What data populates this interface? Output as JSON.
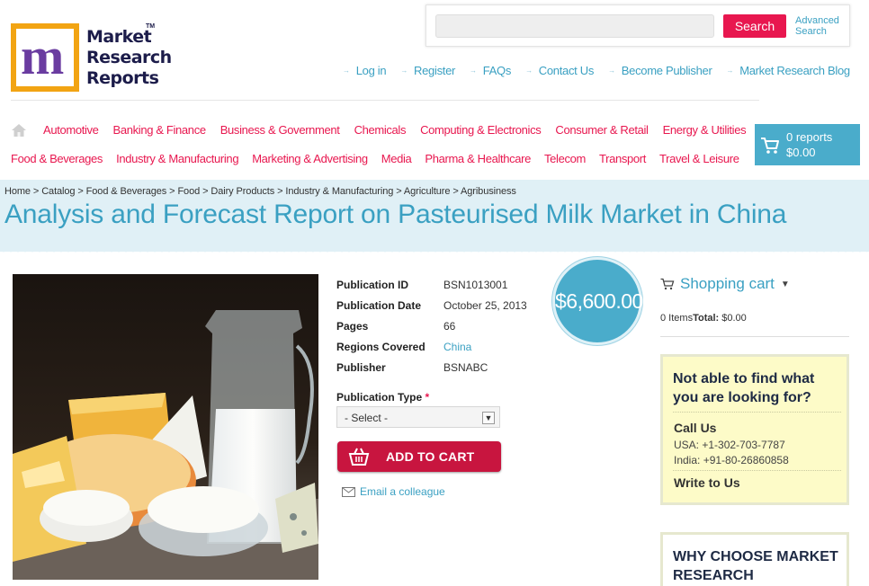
{
  "brand": {
    "logo_letter": "m",
    "name_line1": "Market",
    "name_line2": "Research",
    "name_line3": "Reports",
    "trademark": "TM"
  },
  "search": {
    "placeholder": "",
    "button_label": "Search",
    "advanced_line1": "Advanced",
    "advanced_line2": "Search"
  },
  "top_links": [
    "Log in",
    "Register",
    "FAQs",
    "Contact Us",
    "Become Publisher",
    "Market Research Blog"
  ],
  "categories_row1": [
    "Automotive",
    "Banking & Finance",
    "Business & Government",
    "Chemicals",
    "Computing & Electronics",
    "Consumer & Retail",
    "Energy & Utilities"
  ],
  "categories_row2": [
    "Food & Beverages",
    "Industry & Manufacturing",
    "Marketing & Advertising",
    "Media",
    "Pharma & Healthcare",
    "Telecom",
    "Transport",
    "Travel & Leisure"
  ],
  "cart": {
    "count_label": "0 reports",
    "total": "$0.00"
  },
  "breadcrumb": [
    "Home",
    "Catalog",
    "Food & Beverages",
    "Food",
    "Dairy Products",
    "Industry & Manufacturing",
    "Agriculture",
    "Agribusiness"
  ],
  "breadcrumb_sep": " > ",
  "page_title": "Analysis and Forecast Report on Pasteurised Milk Market in China",
  "product": {
    "price": "$6,600.00",
    "specs": [
      {
        "label": "Publication ID",
        "value": "BSN1013001"
      },
      {
        "label": "Publication Date",
        "value": "October 25, 2013"
      },
      {
        "label": "Pages",
        "value": "66"
      },
      {
        "label": "Regions Covered",
        "value": "China"
      },
      {
        "label": "Publisher",
        "value": "BSNABC"
      }
    ],
    "pubtype_label": "Publication Type",
    "required_mark": "*",
    "pubtype_selected": "- Select -",
    "add_to_cart": "ADD TO CART",
    "email_colleague": "Email a colleague"
  },
  "sidebar": {
    "shopping_cart_title": "Shopping cart",
    "items_text": "0 Items",
    "total_label": "Total:",
    "total_value": "$0.00",
    "help_question": "Not able to find what you are looking for?",
    "call_us": "Call Us",
    "usa_phone": "USA: +1-302-703-7787",
    "india_phone": "India: +91-80-26860858",
    "write_to_us": "Write to Us",
    "why_choose": "WHY CHOOSE MARKET RESEARCH"
  },
  "colors": {
    "accent_blue": "#3aa0c2",
    "accent_pink": "#e8174f",
    "cart_blue": "#4aaccb",
    "band_bg": "#e0f0f6",
    "help_bg": "#fdfbc8"
  }
}
